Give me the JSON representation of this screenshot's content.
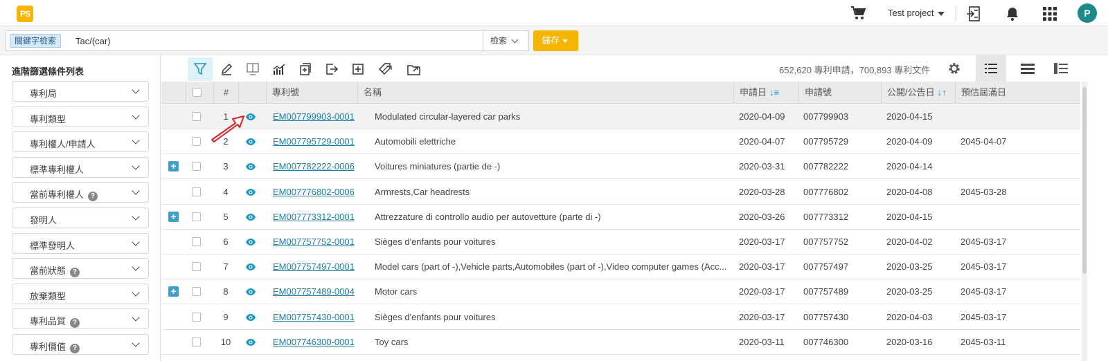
{
  "app": {
    "logo_text": "PS",
    "project": "Test project",
    "avatar_letter": "P"
  },
  "search": {
    "tag": "關鍵字檢索",
    "query": "Tac/(car)",
    "mode": "檢索",
    "save_label": "儲存"
  },
  "sidebar": {
    "title": "進階篩選條件列表",
    "filters": [
      {
        "label": "專利局",
        "help": false
      },
      {
        "label": "專利類型",
        "help": false
      },
      {
        "label": "專利權人/申請人",
        "help": false
      },
      {
        "label": "標準專利權人",
        "help": false
      },
      {
        "label": "當前專利權人",
        "help": true
      },
      {
        "label": "發明人",
        "help": false
      },
      {
        "label": "標準發明人",
        "help": false
      },
      {
        "label": "當前狀態",
        "help": true
      },
      {
        "label": "放棄類型",
        "help": false
      },
      {
        "label": "專利品質",
        "help": true
      },
      {
        "label": "專利價值",
        "help": true
      }
    ]
  },
  "toolbar": {
    "count_text": "652,620 專利申請，700,893 專利文件"
  },
  "table": {
    "headers": {
      "num": "#",
      "patent_no": "專利號",
      "name": "名稱",
      "app_date": "申請日",
      "app_no": "申請號",
      "pub_date": "公開/公告日",
      "expiry": "預估屆滿日"
    },
    "rows": [
      {
        "num": "1",
        "patent_no": "EM007799903-0001",
        "name": "Modulated circular-layered car parks",
        "app_date": "2020-04-09",
        "app_no": "007799903",
        "pub_date": "2020-04-15",
        "expiry": "",
        "expand": false
      },
      {
        "num": "2",
        "patent_no": "EM007795729-0001",
        "name": "Automobili elettriche",
        "app_date": "2020-04-07",
        "app_no": "007795729",
        "pub_date": "2020-04-09",
        "expiry": "2045-04-07",
        "expand": false
      },
      {
        "num": "3",
        "patent_no": "EM007782222-0006",
        "name": "Voitures miniatures (partie de -)",
        "app_date": "2020-03-31",
        "app_no": "007782222",
        "pub_date": "2020-04-14",
        "expiry": "",
        "expand": true
      },
      {
        "num": "4",
        "patent_no": "EM007776802-0006",
        "name": "Armrests,Car headrests",
        "app_date": "2020-03-28",
        "app_no": "007776802",
        "pub_date": "2020-04-08",
        "expiry": "2045-03-28",
        "expand": false
      },
      {
        "num": "5",
        "patent_no": "EM007773312-0001",
        "name": "Attrezzature di controllo audio per autovetture (parte di -)",
        "app_date": "2020-03-26",
        "app_no": "007773312",
        "pub_date": "2020-04-15",
        "expiry": "",
        "expand": true
      },
      {
        "num": "6",
        "patent_no": "EM007757752-0001",
        "name": "Sièges d'enfants pour voitures",
        "app_date": "2020-03-17",
        "app_no": "007757752",
        "pub_date": "2020-04-02",
        "expiry": "2045-03-17",
        "expand": false
      },
      {
        "num": "7",
        "patent_no": "EM007757497-0001",
        "name": "Model cars (part of -),Vehicle parts,Automobiles (part of -),Video computer games (Acc...",
        "app_date": "2020-03-17",
        "app_no": "007757497",
        "pub_date": "2020-03-25",
        "expiry": "2045-03-17",
        "expand": false
      },
      {
        "num": "8",
        "patent_no": "EM007757489-0004",
        "name": "Motor cars",
        "app_date": "2020-03-17",
        "app_no": "007757489",
        "pub_date": "2020-03-25",
        "expiry": "2045-03-17",
        "expand": true
      },
      {
        "num": "9",
        "patent_no": "EM007757430-0001",
        "name": "Sièges d'enfants pour voitures",
        "app_date": "2020-03-17",
        "app_no": "007757430",
        "pub_date": "2020-04-03",
        "expiry": "2045-03-17",
        "expand": false
      },
      {
        "num": "10",
        "patent_no": "EM007746300-0001",
        "name": "Toy cars",
        "app_date": "2020-03-11",
        "app_no": "007746300",
        "pub_date": "2020-03-16",
        "expiry": "2045-03-11",
        "expand": false
      }
    ]
  },
  "colors": {
    "accent": "#1a9ac0",
    "save": "#f5b400",
    "link": "#1a7fa8",
    "annotation_arrow": "#e02020"
  }
}
